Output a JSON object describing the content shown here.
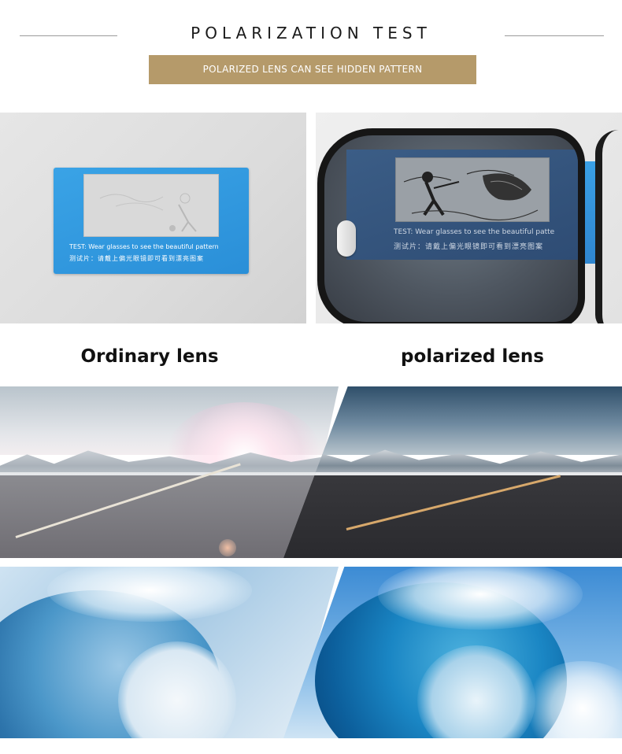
{
  "header": {
    "title": "POLARIZATION TEST",
    "subtitle": "POLARIZED LENS CAN SEE HIDDEN PATTERN"
  },
  "test_card": {
    "line_en": "TEST: Wear glasses to see the beautiful pattern",
    "line_cn": "测试片：请戴上偏光眼镜即可看到漂亮图案",
    "line_en_lens": "TEST: Wear glasses to see the beautiful patte",
    "line_cn_lens": "测试片：请戴上偏光眼镜即可看到漂亮图案"
  },
  "labels": {
    "left": "Ordinary lens",
    "right": "polarized lens"
  },
  "colors": {
    "banner": "#b59a6a",
    "card_blue": "#2f95dc",
    "frame": "#161616"
  }
}
